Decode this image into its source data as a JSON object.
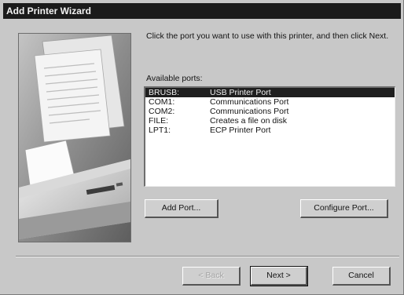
{
  "window": {
    "title": "Add Printer Wizard"
  },
  "instruction": "Click the port you want to use with this printer, and then click Next.",
  "ports": {
    "label": "Available ports:",
    "items": [
      {
        "name": "BRUSB:",
        "description": "USB Printer Port",
        "selected": true
      },
      {
        "name": "COM1:",
        "description": "Communications Port",
        "selected": false
      },
      {
        "name": "COM2:",
        "description": "Communications Port",
        "selected": false
      },
      {
        "name": "FILE:",
        "description": "Creates a file on disk",
        "selected": false
      },
      {
        "name": "LPT1:",
        "description": "ECP Printer Port",
        "selected": false
      }
    ]
  },
  "buttons": {
    "add_port": "Add Port...",
    "configure_port": "Configure Port...",
    "back": "< Back",
    "next": "Next >",
    "cancel": "Cancel"
  }
}
